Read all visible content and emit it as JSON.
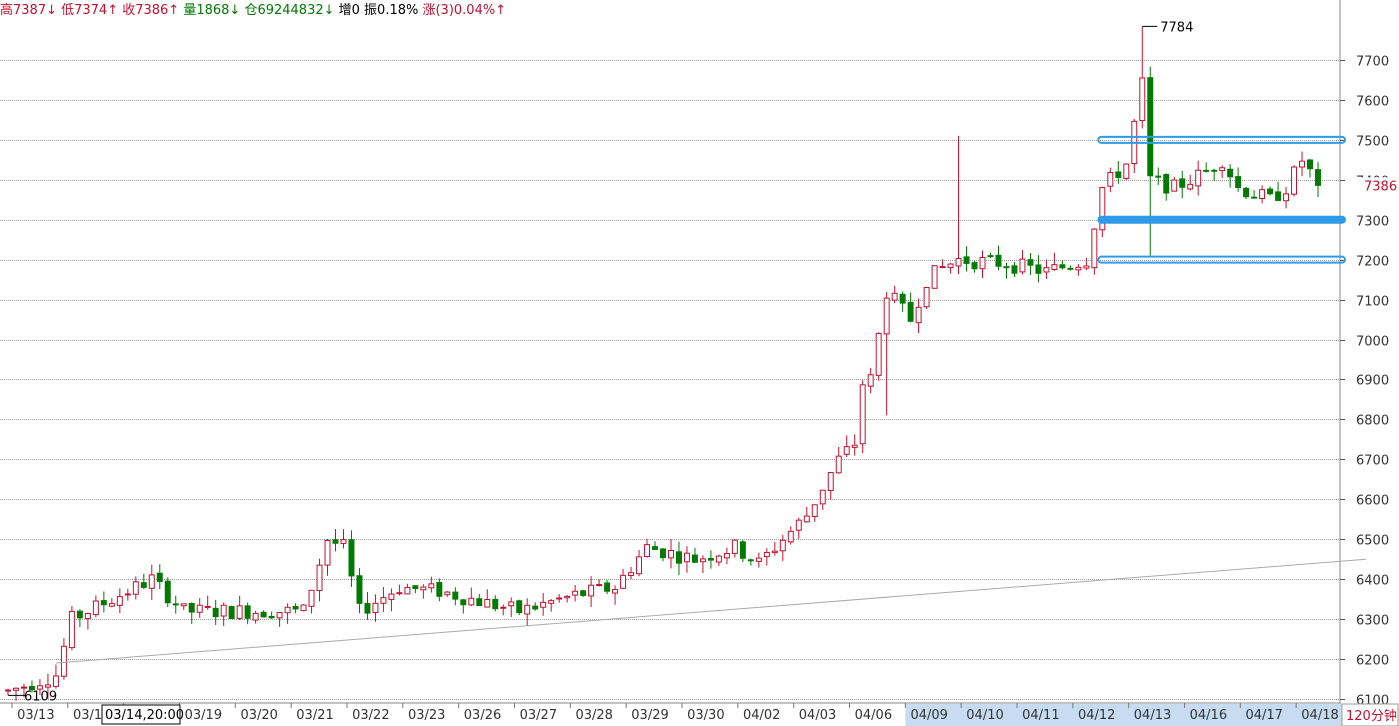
{
  "header": {
    "items": [
      {
        "label": "高",
        "value": "7387",
        "arrow": "↓",
        "color": "#c8102e"
      },
      {
        "label": "低",
        "value": "7374",
        "arrow": "↑",
        "color": "#c8102e"
      },
      {
        "label": "收",
        "value": "7386",
        "arrow": "↑",
        "color": "#c8102e"
      },
      {
        "label": "量",
        "value": "1868",
        "arrow": "↓",
        "color": "#007a00"
      },
      {
        "label": "仓",
        "value": "69244832",
        "arrow": "↓",
        "color": "#007a00"
      },
      {
        "label": "增",
        "value": "0",
        "arrow": "",
        "color": "#000000"
      },
      {
        "label": "振",
        "value": "0.18%",
        "arrow": "",
        "color": "#000000"
      },
      {
        "label": "涨",
        "value": "(3)0.04%",
        "arrow": "↑",
        "color": "#c8102e"
      }
    ]
  },
  "period_label": "120分钟",
  "colors": {
    "up": "#c8102e",
    "down": "#007a00",
    "grid": "#999999",
    "box": "#2e9be8",
    "axis_text": "#333333",
    "highlight": "#c7dcf1"
  },
  "chart_data": {
    "type": "candlestick",
    "ylim": [
      6090,
      7800
    ],
    "y_ticks": [
      6100,
      6200,
      6300,
      6400,
      6500,
      6600,
      6700,
      6800,
      6900,
      7000,
      7100,
      7200,
      7300,
      7400,
      7500,
      7600,
      7700
    ],
    "grid": true,
    "last_price": "7386",
    "max_label": "7784",
    "min_label": "6109",
    "crosshair_label": "03/14,20:00",
    "date_labels": [
      "03/13",
      "03/14",
      "03/16",
      "03/19",
      "03/20",
      "03/21",
      "03/22",
      "03/23",
      "03/26",
      "03/27",
      "03/28",
      "03/29",
      "03/30",
      "04/02",
      "04/03",
      "04/06",
      "04/09",
      "04/10",
      "04/11",
      "04/12",
      "04/13",
      "04/16",
      "04/17",
      "04/18"
    ],
    "highlight_dates": [
      "04/09",
      "04/10",
      "04/11",
      "04/12",
      "04/13",
      "04/16",
      "04/17",
      "04/18"
    ],
    "anchors": [
      [
        0,
        6120
      ],
      [
        6,
        6160
      ],
      [
        8,
        6300
      ],
      [
        18,
        6400
      ],
      [
        22,
        6320
      ],
      [
        28,
        6320
      ],
      [
        37,
        6320
      ],
      [
        40,
        6500
      ],
      [
        42,
        6480
      ],
      [
        44,
        6320
      ],
      [
        49,
        6380
      ],
      [
        54,
        6370
      ],
      [
        64,
        6320
      ],
      [
        71,
        6360
      ],
      [
        76,
        6380
      ],
      [
        80,
        6480
      ],
      [
        86,
        6450
      ],
      [
        91,
        6480
      ],
      [
        94,
        6440
      ],
      [
        100,
        6560
      ],
      [
        104,
        6700
      ],
      [
        106,
        6740
      ],
      [
        107,
        6890
      ],
      [
        108,
        6900
      ],
      [
        110,
        7120
      ],
      [
        113,
        7050
      ],
      [
        115,
        7150
      ],
      [
        117,
        7180
      ],
      [
        119,
        7200
      ],
      [
        125,
        7190
      ],
      [
        130,
        7170
      ],
      [
        135,
        7200
      ],
      [
        137,
        7380
      ],
      [
        140,
        7440
      ],
      [
        142,
        7640
      ],
      [
        143,
        7400
      ],
      [
        146,
        7380
      ],
      [
        150,
        7420
      ],
      [
        152,
        7450
      ],
      [
        154,
        7380
      ],
      [
        158,
        7350
      ],
      [
        160,
        7380
      ],
      [
        162,
        7450
      ],
      [
        163,
        7420
      ],
      [
        164,
        7385
      ]
    ],
    "trendline": {
      "start": [
        6.0,
        6190
      ],
      "end": [
        170.0,
        6450
      ]
    },
    "support_boxes": [
      7500,
      7300,
      7200
    ]
  }
}
